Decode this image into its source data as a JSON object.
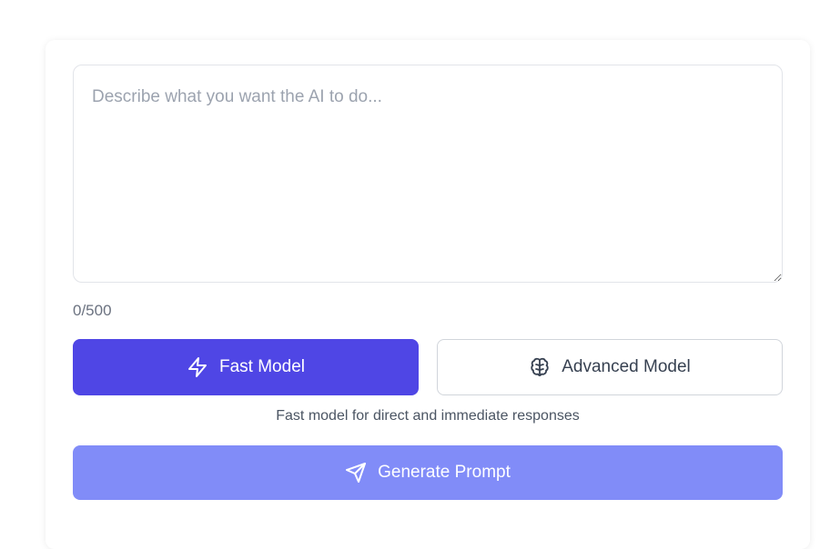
{
  "prompt": {
    "placeholder": "Describe what you want the AI to do...",
    "value": "",
    "counter": "0/500"
  },
  "models": {
    "fast": {
      "label": "Fast Model",
      "icon": "lightning-icon",
      "selected": true
    },
    "advanced": {
      "label": "Advanced Model",
      "icon": "brain-icon",
      "selected": false
    },
    "description": "Fast model for direct and immediate responses"
  },
  "generate": {
    "label": "Generate Prompt",
    "icon": "send-icon"
  },
  "colors": {
    "accent": "#4f46e5",
    "generate_bg": "#818cf8",
    "border": "#d1d5db",
    "placeholder": "#9ca3af"
  }
}
